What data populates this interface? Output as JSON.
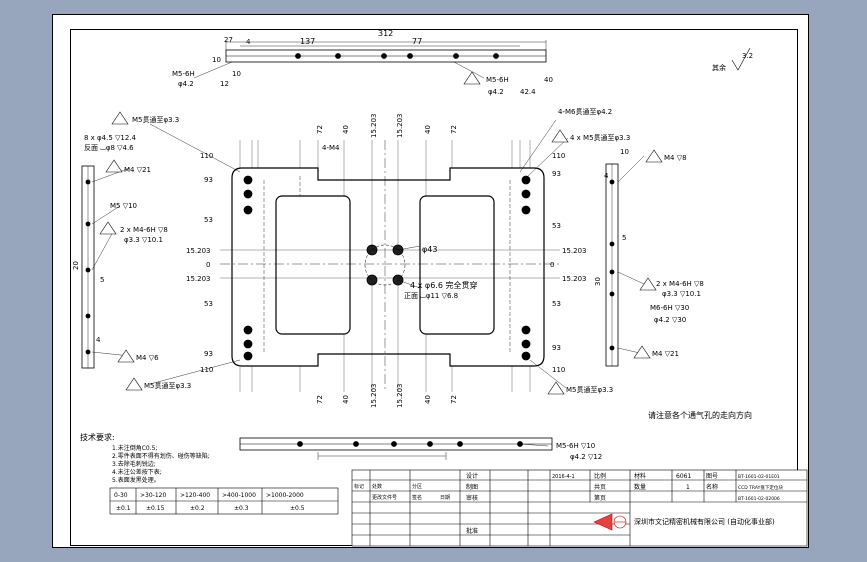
{
  "surface_roughness": "3.2",
  "surface_roughness_label": "其余",
  "note_title": "技术要求:",
  "notes": [
    "1.未注倒角C0.5;",
    "2.零件表面不得有划伤、碰伤等缺陷;",
    "3.去除毛刺锐边;",
    "4.未注公差按下表;",
    "5.表面发黑处理。"
  ],
  "tolerance_table": {
    "ranges": [
      "0-30",
      ">30-120",
      ">120-400",
      ">400-1000",
      ">1000-2000"
    ],
    "values": [
      "±0.1",
      "±0.15",
      "±0.2",
      "±0.3",
      "±0.5"
    ]
  },
  "callouts": {
    "top_left_thread": "M5-6H",
    "top_left_depth": "10",
    "top_left_drill": "φ4.2",
    "top_left_drill_depth": "12",
    "top_right_thread": "M5-6H",
    "top_right_depth": "40",
    "top_right_drill": "φ4.2",
    "top_right_drill_depth": "42.4",
    "dim_312": "312",
    "dim_137": "137",
    "dim_77": "77",
    "dim_4": "4",
    "dim_27": "27",
    "dim_10": "10",
    "m5_through_33": "M5贯通至φ3.3",
    "hole_45": "8 x φ4.5 ▽12.4",
    "hole_8": "反面 ⌴φ8 ▽4.6",
    "m4_21": "M4 ▽21",
    "m5_10": "M5 ▽10",
    "m4_6h": "2 x M4-6H ▽8",
    "drill_33": "φ3.3 ▽10.1",
    "m4_6": "M4 ▽6",
    "m5_33": "M5贯通至φ3.3",
    "m6_through": "4-M6贯通至φ4.2",
    "four_m5": "4 x M5贯通至φ3.3",
    "m4_8": "M4 ▽8",
    "r_m4_6h": "2 x M4-6H ▽8",
    "r_drill": "φ3.3 ▽10.1",
    "m6_6h": "M6-6H ▽30",
    "m6_drill": "φ4.2 ▽30",
    "m4_r": "M4 ▽21",
    "phi43": "φ43",
    "hole66": "4 x φ6.6 完全贯穿",
    "hole11": "正面 ⌴φ11 ▽6.8",
    "m4_bottom": "4-M4",
    "bottom_thread": "M5-6H ▽10",
    "bottom_drill": "φ4.2 ▽12",
    "note_air": "请注意各个通气孔的走向方向",
    "dim_0": "0",
    "dim_15203": "15.203",
    "dim_40": "40",
    "dim_72": "72",
    "dim_110": "110",
    "dim_93": "93",
    "dim_53": "53",
    "dim_5": "5",
    "dim_20": "20",
    "dim_30": "30"
  },
  "title_block": {
    "company": "深圳市文记精密机械有限公司 (自动化事业部)",
    "material_label": "材料",
    "material": "6061",
    "drawing_no_label": "图号",
    "drawing_no": "BT-1601-02-01E01",
    "part_name_label": "名称",
    "part_name": "CCD TRAY盘下定位块",
    "assembly_no": "BT-1601-02-02006",
    "quantity_label": "数量",
    "quantity": "1",
    "scale_label": "比例",
    "sheet_label": "共页",
    "sheet_label2": "第页",
    "designer_label": "设计",
    "checker_label": "审核",
    "approver_label": "批准",
    "drawer_label": "制图",
    "date": "2016-4-1",
    "rev_header": [
      "标记",
      "处数",
      "分区",
      "更改文件号",
      "签名",
      "日期"
    ]
  }
}
